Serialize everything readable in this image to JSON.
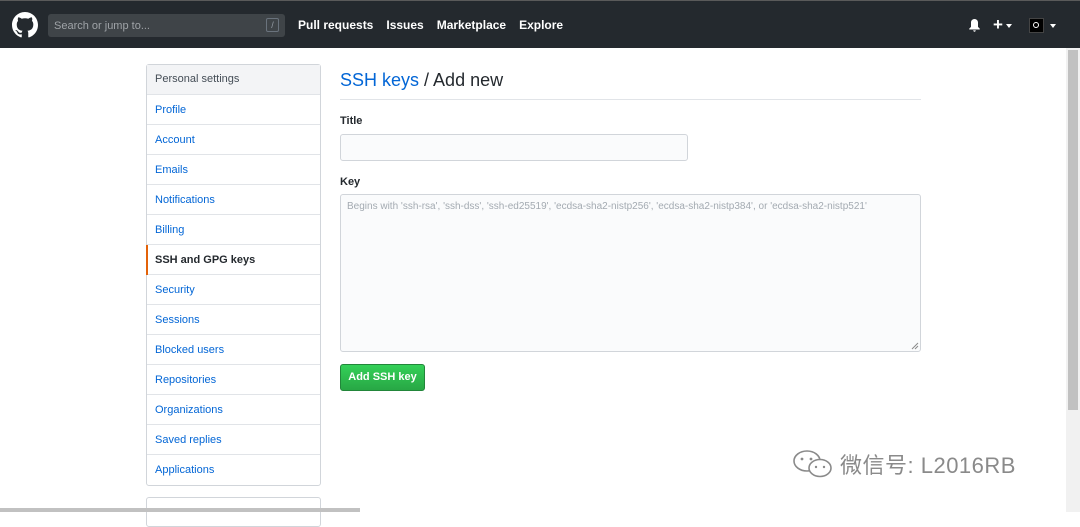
{
  "header": {
    "search": {
      "placeholder": "Search or jump to...",
      "shortcut": "/"
    },
    "nav": [
      "Pull requests",
      "Issues",
      "Marketplace",
      "Explore"
    ],
    "plus_label": "+"
  },
  "sidebar": {
    "heading": "Personal settings",
    "items": [
      {
        "label": "Profile"
      },
      {
        "label": "Account"
      },
      {
        "label": "Emails"
      },
      {
        "label": "Notifications"
      },
      {
        "label": "Billing"
      },
      {
        "label": "SSH and GPG keys",
        "selected": true
      },
      {
        "label": "Security"
      },
      {
        "label": "Sessions"
      },
      {
        "label": "Blocked users"
      },
      {
        "label": "Repositories"
      },
      {
        "label": "Organizations"
      },
      {
        "label": "Saved replies"
      },
      {
        "label": "Applications"
      }
    ]
  },
  "main": {
    "breadcrumb": "SSH keys",
    "separator": " / ",
    "title": "Add new",
    "title_label": "Title",
    "title_value": "",
    "key_label": "Key",
    "key_placeholder": "Begins with 'ssh-rsa', 'ssh-dss', 'ssh-ed25519', 'ecdsa-sha2-nistp256', 'ecdsa-sha2-nistp384', or 'ecdsa-sha2-nistp521'",
    "submit_label": "Add SSH key"
  },
  "watermark": {
    "text": "微信号: L2016RB"
  },
  "colors": {
    "header_bg": "#24292e",
    "link": "#0366d6",
    "selected_marker": "#e36209",
    "button_green": "#28a745"
  }
}
